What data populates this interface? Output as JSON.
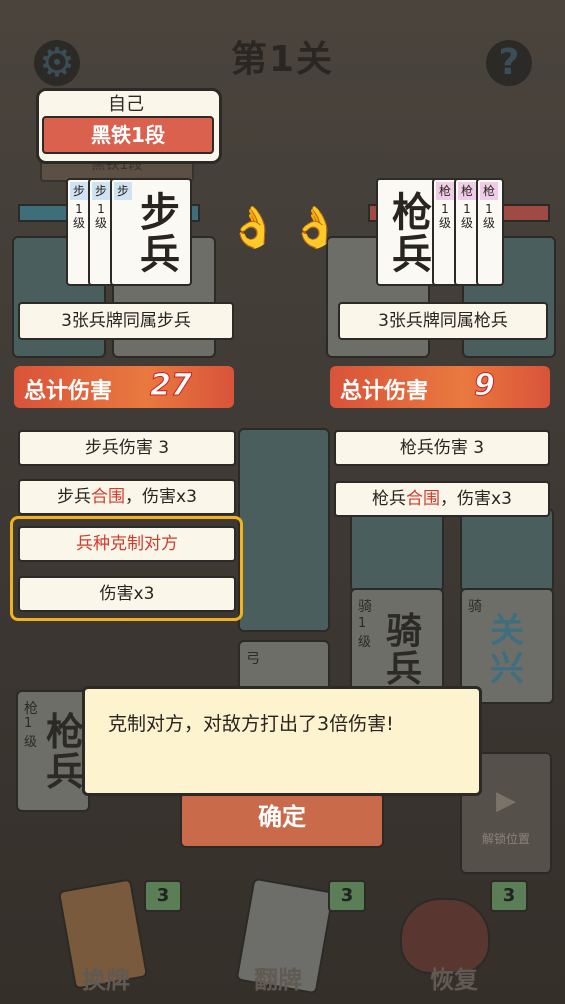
{
  "header": {
    "level_title": "第1关",
    "settings_icon": "gear-icon",
    "help_icon": "question-icon"
  },
  "player": {
    "name": "自己",
    "rank": "黑铁1段",
    "rank_behind": "黑铁1段"
  },
  "left_hand": {
    "small_cards": [
      {
        "unit": "步",
        "level": "1级"
      },
      {
        "unit": "步",
        "level": "1级"
      },
      {
        "unit": "步",
        "level": ""
      }
    ],
    "main_card": "步兵",
    "combo_label": "3张兵牌同属步兵",
    "total_damage_label": "总计伤害",
    "total_damage_value": "27",
    "breakdown": [
      {
        "text": "步兵伤害 3"
      },
      {
        "pre": "步兵",
        "red": "合围",
        "post": "，伤害x3"
      },
      {
        "red": "兵种克制对方"
      },
      {
        "text": "伤害x3"
      }
    ]
  },
  "right_hand": {
    "small_cards": [
      {
        "unit": "枪",
        "level": "1级"
      },
      {
        "unit": "枪",
        "level": "1级"
      },
      {
        "unit": "枪",
        "level": "1级"
      }
    ],
    "main_card": "枪兵",
    "combo_label": "3张兵牌同属枪兵",
    "total_damage_label": "总计伤害",
    "total_damage_value": "9",
    "breakdown": [
      {
        "text": "枪兵伤害 3"
      },
      {
        "pre": "枪兵",
        "red": "合围",
        "post": "，伤害x3"
      }
    ]
  },
  "board": {
    "cavalry_card": {
      "unit": "骑",
      "level": "1级",
      "name": "骑兵"
    },
    "hero_card": {
      "unit": "骑",
      "name": "关兴"
    },
    "spear_card": {
      "unit": "枪",
      "level": "1级",
      "name": "枪兵"
    },
    "bow_card": {
      "unit": "弓",
      "name": "弓"
    },
    "unlock_slot_label": "解锁位置"
  },
  "dialog": {
    "message": "克制对方，对敌方打出了3倍伤害!",
    "confirm_label": "确定"
  },
  "tools": [
    {
      "label": "换牌",
      "count": "3"
    },
    {
      "label": "翻牌",
      "count": "3"
    },
    {
      "label": "恢复",
      "count": "3"
    }
  ],
  "colors": {
    "damage_banner": "#e9793f",
    "highlight_border": "#f3b21a",
    "accent_red": "#d63b2b",
    "dialog_bg": "#fdf3cf"
  }
}
